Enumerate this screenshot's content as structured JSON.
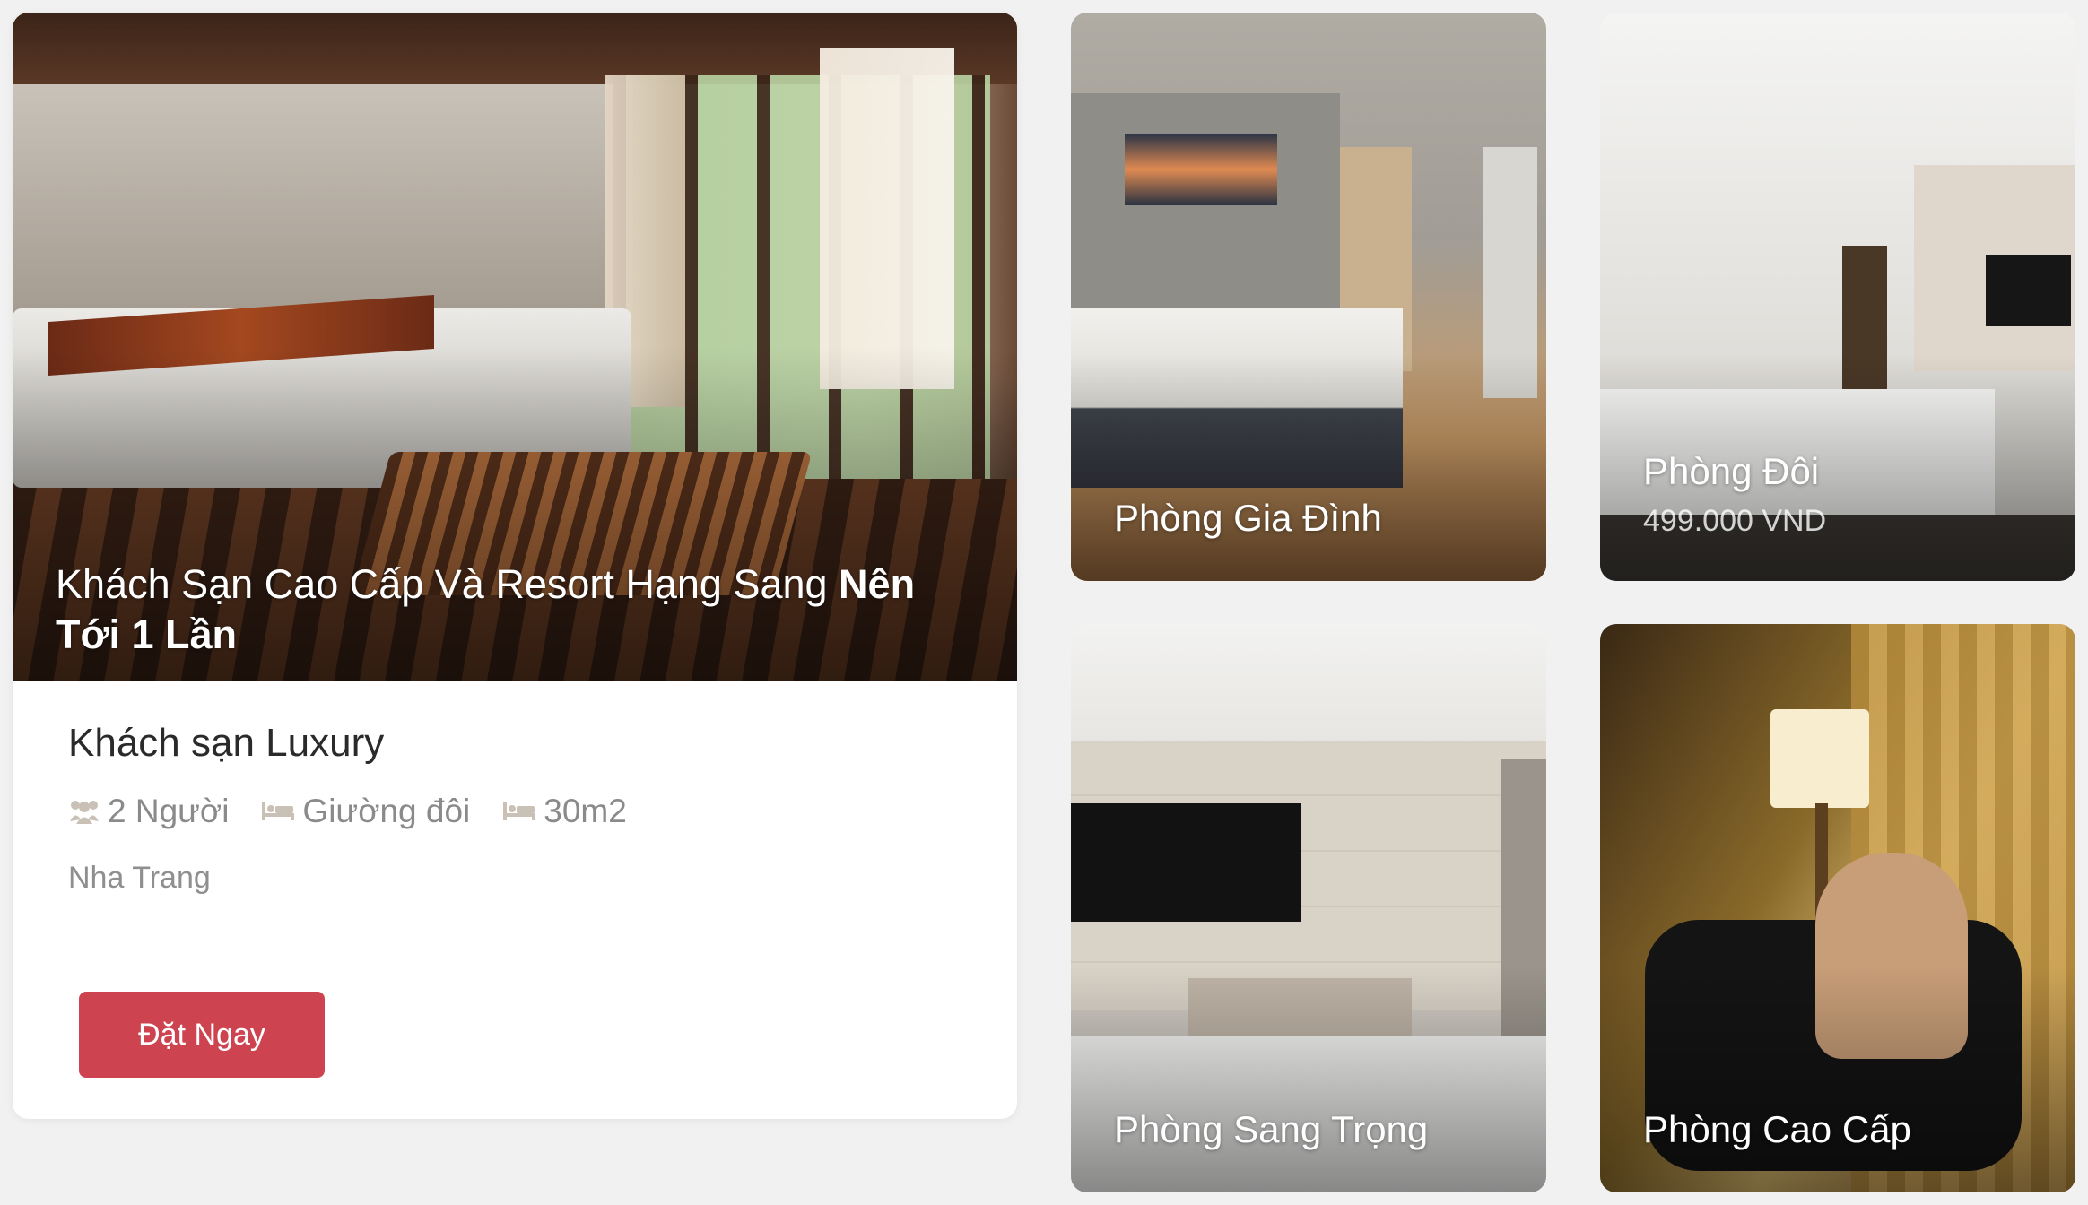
{
  "featured": {
    "headline_regular": "Khách Sạn Cao Cấp Và Resort Hạng Sang ",
    "headline_bold": "Nên Tới 1 Lần",
    "hotel_name": "Khách sạn Luxury",
    "amenities": [
      {
        "icon": "users-icon",
        "label": "2 Người"
      },
      {
        "icon": "bed-icon",
        "label": "Giường đôi"
      },
      {
        "icon": "bed-icon",
        "label": "30m2"
      }
    ],
    "location": "Nha Trang",
    "book_label": "Đặt Ngay"
  },
  "rooms": [
    {
      "title": "Phòng Gia Đình"
    },
    {
      "title": "Phòng Đôi",
      "price": "499.000 VND"
    },
    {
      "title": "Phòng Sang Trọng"
    },
    {
      "title": "Phòng Cao Cấp"
    }
  ],
  "colors": {
    "background": "#f1f1f1",
    "button": "#cd4450",
    "icon": "#c9c1b6"
  }
}
